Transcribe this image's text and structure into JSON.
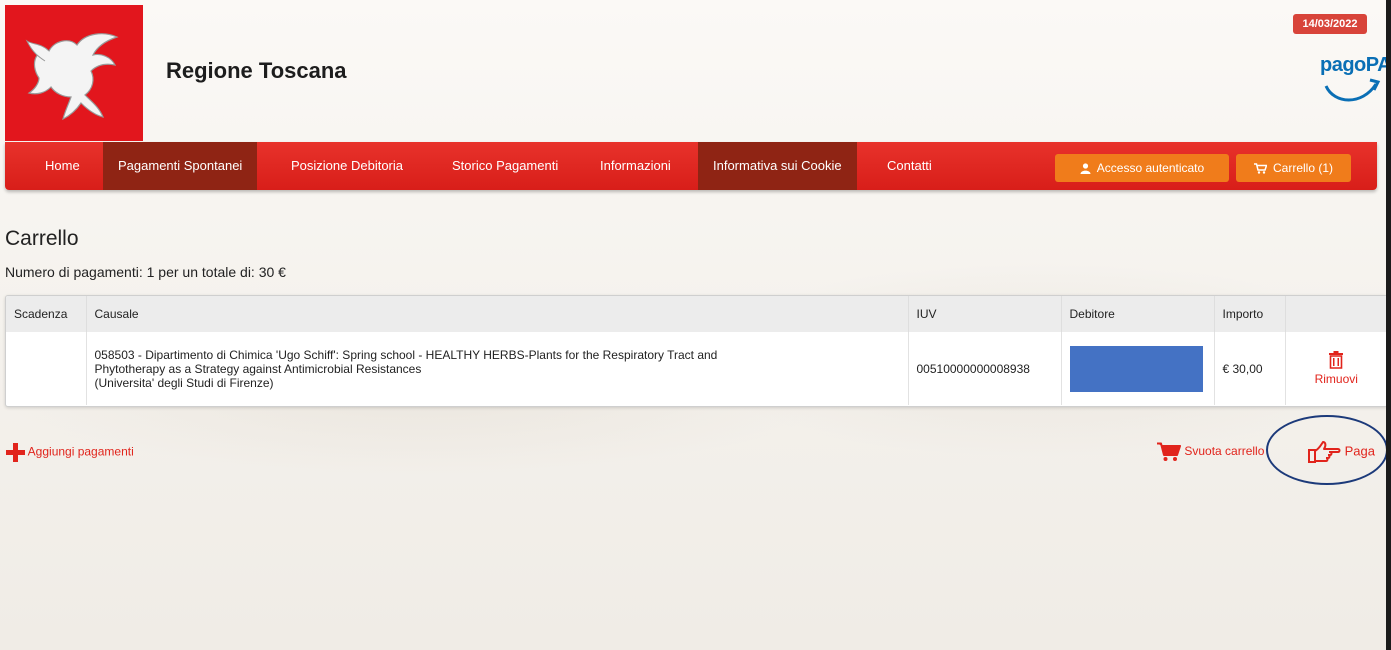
{
  "header": {
    "brand": "Regione Toscana",
    "date": "14/03/2022",
    "pagopa_logo": "pagoPA"
  },
  "nav": {
    "items": [
      {
        "label": "Home"
      },
      {
        "label": "Pagamenti Spontanei"
      },
      {
        "label": "Posizione Debitoria"
      },
      {
        "label": "Storico Pagamenti"
      },
      {
        "label": "Informazioni"
      },
      {
        "label": "Informativa sui Cookie"
      },
      {
        "label": "Contatti"
      }
    ],
    "login_label": "Accesso autenticato",
    "cart_label": "Carrello (1)"
  },
  "page": {
    "title": "Carrello",
    "summary": "Numero di pagamenti: 1  per un totale di: 30 €"
  },
  "table": {
    "headers": {
      "scadenza": "Scadenza",
      "causale": "Causale",
      "iuv": "IUV",
      "debitore": "Debitore",
      "importo": "Importo"
    },
    "rows": [
      {
        "scadenza": "",
        "causale_line1": "058503 - Dipartimento di Chimica 'Ugo Schiff': Spring school - HEALTHY HERBS-Plants for the Respiratory Tract and",
        "causale_line2": "Phytotherapy as a Strategy against Antimicrobial Resistances",
        "causale_line3": "(Universita' degli Studi di Firenze)",
        "iuv": "00510000000008938",
        "importo": "€ 30,00",
        "remove_label": "Rimuovi"
      }
    ]
  },
  "actions": {
    "add": "Aggiungi pagamenti",
    "empty": "Svuota carrello",
    "pay": "Paga"
  },
  "colors": {
    "accent": "#e1241c",
    "nav_bg": "#dc231d",
    "nav_active": "#8f2414",
    "button_orange": "#f07c1b"
  },
  "icons": {
    "logo": "pegasus-logo-icon",
    "login": "user-icon",
    "cart": "cart-icon",
    "trash": "trash-icon",
    "plus": "plus-icon",
    "pay": "hand-pointer-icon"
  }
}
